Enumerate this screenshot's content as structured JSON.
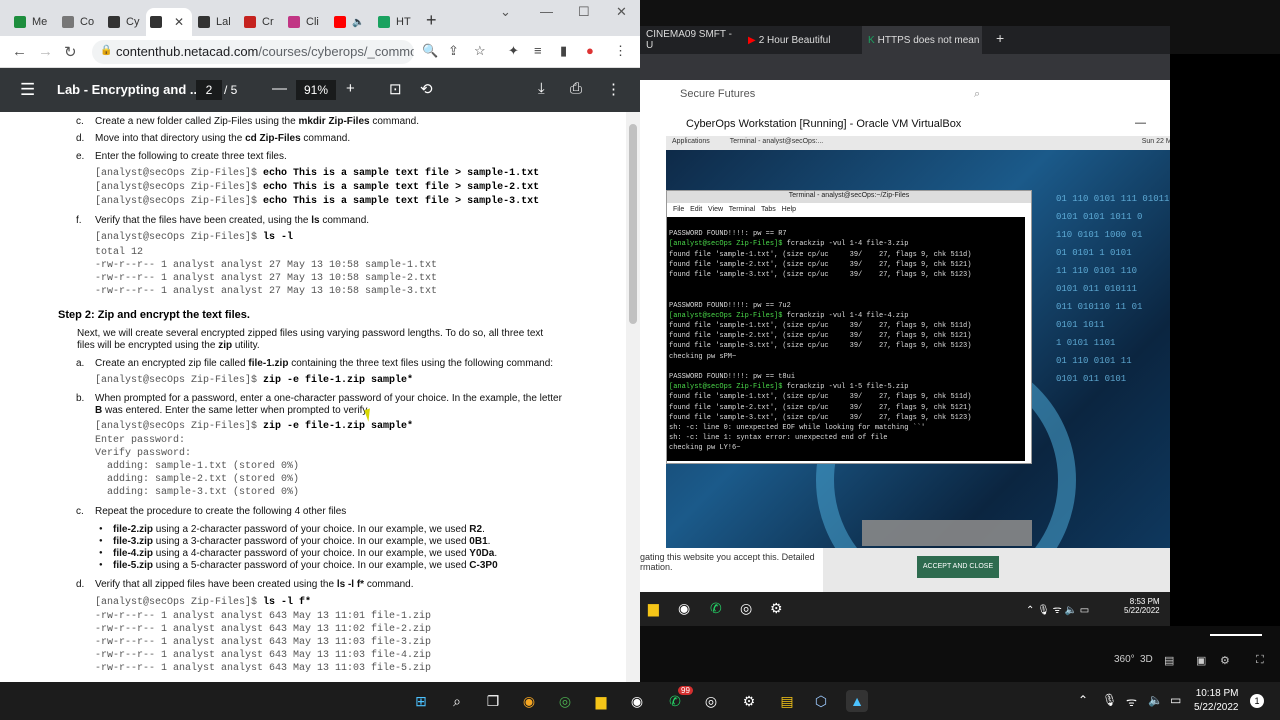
{
  "left_browser": {
    "tabs": [
      {
        "label": "Me",
        "color": "#1e8e3e"
      },
      {
        "label": "Co",
        "color": "#555555"
      },
      {
        "label": "Cy",
        "color": "#333333"
      },
      {
        "label": "",
        "color": "#333333"
      },
      {
        "label": "Lal",
        "color": "#333333"
      },
      {
        "label": "Cr",
        "color": "#c5221f"
      },
      {
        "label": "Cli",
        "color": "#c13584"
      },
      {
        "label": "",
        "color": "#ff0000"
      },
      {
        "label": "HT",
        "color": "#1aa260"
      }
    ],
    "url_domain": "contenthub.netacad.com",
    "url_path": "/courses/cyberops/_common/...",
    "pdf": {
      "title": "Lab - Encrypting and ...",
      "page_current": "2",
      "page_total": "5",
      "zoom": "91%"
    }
  },
  "doc": {
    "c1_label": "c.",
    "c1_text_a": "Create a new folder called Zip-Files using the ",
    "c1_cmd": "mkdir Zip-Files",
    "c1_text_b": " command.",
    "d1_label": "d.",
    "d1_text_a": "Move into that directory using the ",
    "d1_cmd": "cd Zip-Files",
    "d1_text_b": " command.",
    "e1_label": "e.",
    "e1_text": "Enter the following to create three text files.",
    "prompt": "[analyst@secOps Zip-Files]$ ",
    "echo1": "echo This is a sample text file > sample-1.txt",
    "echo2": "echo This is a sample text file > sample-2.txt",
    "echo3": "echo This is a sample text file > sample-3.txt",
    "f1_label": "f.",
    "f1_text_a": "Verify that the files have been created, using the ",
    "f1_cmd": "ls",
    "f1_text_b": " command.",
    "ls_cmd": "ls -l",
    "ls_out": [
      "total 12",
      "-rw-r--r-- 1 analyst analyst 27 May 13 10:58 sample-1.txt",
      "-rw-r--r-- 1 analyst analyst 27 May 13 10:58 sample-2.txt",
      "-rw-r--r-- 1 analyst analyst 27 May 13 10:58 sample-3.txt"
    ],
    "step2": "Step 2: Zip and encrypt the text files.",
    "intro1": "Next, we will create several encrypted zipped files using varying password lengths. To do so, all three text",
    "intro2a": "files will be encrypted using the ",
    "intro2_cmd": "zip",
    "intro2b": " utility.",
    "a_label": "a.",
    "a_text_a": "Create an encrypted zip file called ",
    "a_file": "file-1.zip",
    "a_text_b": " containing the three text files using the following command:",
    "zip_cmd": "zip -e file-1.zip sample*",
    "b_label": "b.",
    "b_text1": "When prompted for a password, enter a one-character password of your choice. In the example, the letter",
    "b_letter": "B",
    "b_text2": " was entered. Enter the same letter when prompted to verify.",
    "zip_out": [
      "Enter password:",
      "Verify password:",
      "  adding: sample-1.txt (stored 0%)",
      "  adding: sample-2.txt (stored 0%)",
      "  adding: sample-3.txt (stored 0%)"
    ],
    "c2_label": "c.",
    "c2_text": "Repeat the procedure to create the following 4 other files",
    "bullets": [
      {
        "file": "file-2.zip",
        "mid": " using a 2-character password of your choice. In our example, we used ",
        "pw": "R2"
      },
      {
        "file": "file-3.zip",
        "mid": " using a 3-character password of your choice. In our example, we used ",
        "pw": "0B1"
      },
      {
        "file": "file-4.zip",
        "mid": " using a 4-character password of your choice. In our example, we used ",
        "pw": "Y0Da"
      },
      {
        "file": "file-5.zip",
        "mid": " using a 5-character password of your choice. In our example, we used ",
        "pw": "C-3P0"
      }
    ],
    "d2_label": "d.",
    "d2_text_a": "Verify that all zipped files have been created using the ",
    "d2_cmd": "ls -l f*",
    "d2_text_b": " command.",
    "lsf_cmd": "ls -l f*",
    "lsf_out": [
      "-rw-r--r-- 1 analyst analyst 643 May 13 11:01 file-1.zip",
      "-rw-r--r-- 1 analyst analyst 643 May 13 11:02 file-2.zip",
      "-rw-r--r-- 1 analyst analyst 643 May 13 11:03 file-3.zip",
      "-rw-r--r-- 1 analyst analyst 643 May 13 11:03 file-4.zip",
      "-rw-r--r-- 1 analyst analyst 643 May 13 11:03 file-5.zip"
    ]
  },
  "right_browser": {
    "tabs": [
      "CINEMA09 SMFT - U",
      "2 Hour Beautiful",
      "HTTPS does not mean"
    ],
    "page_text": "Secure Futures",
    "cookie_text1": "gating this website you accept this. Detailed",
    "cookie_text2": "rmation.",
    "accept_label": "ACCEPT AND CLOSE",
    "time": "8:53 PM",
    "date": "5/22/2022"
  },
  "vbox": {
    "title": "CyberOps Workstation [Running] - Oracle VM VirtualBox",
    "guest_apps": "Applications",
    "guest_term_tab": "Terminal - analyst@secOps:...",
    "guest_clock": "Sun 22 May, 10:18",
    "guest_user": "analyst",
    "term_title": "Terminal - analyst@secOps:~/Zip-Files",
    "term_menu": [
      "File",
      "Edit",
      "View",
      "Terminal",
      "Tabs",
      "Help"
    ],
    "term_lines": [
      "",
      "PASSWORD FOUND!!!!: pw == R7",
      "[analyst@secOps Zip-Files]$ fcrackzip -vul 1-4 file-3.zip",
      "found file 'sample-1.txt', (size cp/uc     39/    27, flags 9, chk 511d)",
      "found file 'sample-2.txt', (size cp/uc     39/    27, flags 9, chk 5121)",
      "found file 'sample-3.txt', (size cp/uc     39/    27, flags 9, chk 5123)",
      "",
      "",
      "PASSWORD FOUND!!!!: pw == 7u2",
      "[analyst@secOps Zip-Files]$ fcrackzip -vul 1-4 file-4.zip",
      "found file 'sample-1.txt', (size cp/uc     39/    27, flags 9, chk 511d)",
      "found file 'sample-2.txt', (size cp/uc     39/    27, flags 9, chk 5121)",
      "found file 'sample-3.txt', (size cp/uc     39/    27, flags 9, chk 5123)",
      "checking pw sPM~",
      "",
      "PASSWORD FOUND!!!!: pw == t8ui",
      "[analyst@secOps Zip-Files]$ fcrackzip -vul 1-5 file-5.zip",
      "found file 'sample-1.txt', (size cp/uc     39/    27, flags 9, chk 511d)",
      "found file 'sample-2.txt', (size cp/uc     39/    27, flags 9, chk 5121)",
      "found file 'sample-3.txt', (size cp/uc     39/    27, flags 9, chk 5123)",
      "sh: -c: line 0: unexpected EOF while looking for matching ``'",
      "sh: -c: line 1: syntax error: unexpected end of file",
      "checking pw LY!6~"
    ]
  },
  "taskbar": {
    "time": "10:18 PM",
    "date": "5/22/2022",
    "notif": "1",
    "badge": "99"
  }
}
